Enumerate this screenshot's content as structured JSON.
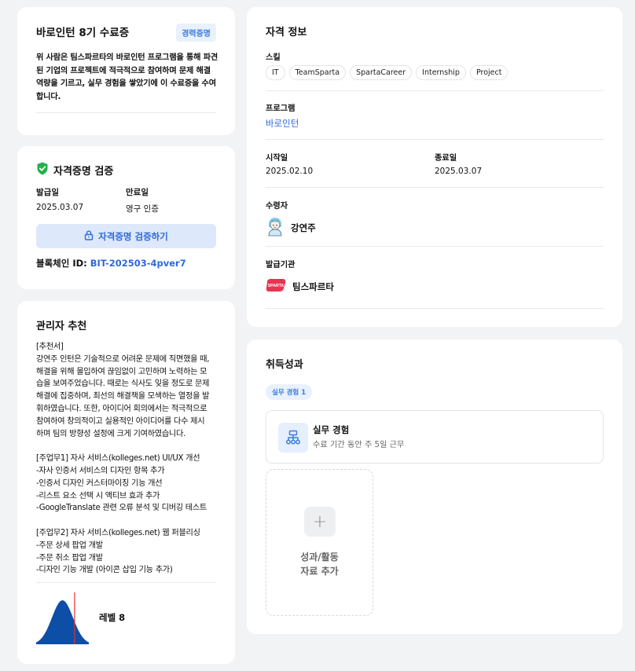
{
  "certificate": {
    "title": "바로인턴 8기 수료증",
    "badge": "경력증명",
    "description": "위 사람은 팀스파르타의 바로인턴 프로그램을 통해 파견된 기업의 프로젝트에 적극적으로 참여하며 문제 해결 역량을 기르고, 실무 경험을 쌓았기에 이 수료증을 수여합니다."
  },
  "verification": {
    "title": "자격증명 검증",
    "issued_label": "발급일",
    "issued_value": "2025.03.07",
    "expiry_label": "만료일",
    "expiry_value": "영구 인증",
    "verify_button": "자격증명 검증하기",
    "blockchain_label": "블록체인 ID:",
    "blockchain_id": "BIT-202503-4pver7",
    "colors": {
      "check": "#22b14c",
      "accent": "#2e6ad8",
      "button_bg": "#dde8fb"
    }
  },
  "recommendation": {
    "title": "관리자 추천",
    "lines": [
      "[추천서]",
      "강연주 인턴은 기술적으로 어려운 문제에 직면했을 때,",
      "해결을 위해 몰입하여 끊임없이 고민하며 노력하는 모",
      "습을 보여주었습니다. 때로는 식사도 잊을 정도로 문제",
      "해결에 집중하며, 최선의 해결책을 모색하는 열정을 발",
      "휘하였습니다. 또한, 아이디어 회의에서는 적극적으로",
      "참여하여 창의적이고 실용적인 아이디어를 다수 제시",
      "하며 팀의 방향성 설정에 크게 기여하였습니다.",
      "",
      "[주업무1] 자사 서비스(kolleges.net) UI/UX 개선",
      "-자사 인증서 서비스의 디자인 항목 추가",
      "-인증서 디자인 커스터마이징 기능 개선",
      "-리스트 요소 선택 시 액티브 효과 추가",
      "-GoogleTranslate 관련 오류 분석 및 디버깅 테스트",
      "",
      "[주업무2] 자사 서비스(kolleges.net) 웹 퍼블리싱",
      "-주문 상세 팝업 개발",
      "-주문 취소 팝업 개발",
      "-디자인 기능 개발 (아이콘 삽입 기능 추가)"
    ],
    "level_label": "레벨 8",
    "level_chart": {
      "position": 0.73,
      "curve_color": "#0d4ea6",
      "marker_color": "#e53030"
    }
  },
  "qualification": {
    "title": "자격 정보",
    "skills_label": "스킬",
    "skills": [
      "IT",
      "TeamSparta",
      "SpartaCareer",
      "Internship",
      "Project"
    ],
    "program_label": "프로그램",
    "program_value": "바로인턴",
    "start_label": "시작일",
    "start_value": "2025.02.10",
    "end_label": "종료일",
    "end_value": "2025.03.07",
    "recipient_label": "수령자",
    "recipient_name": "강연주",
    "issuer_label": "발급기관",
    "issuer_name": "팀스파르타",
    "issuer_logo_text": "SPARTA"
  },
  "achievements": {
    "title": "취득성과",
    "tag": "실무 경험 1",
    "item_title": "실무 경험",
    "item_subtitle": "수료 기간 동안 주 5일 근무",
    "add_label_line1": "성과/활동",
    "add_label_line2": "자료 추가"
  }
}
